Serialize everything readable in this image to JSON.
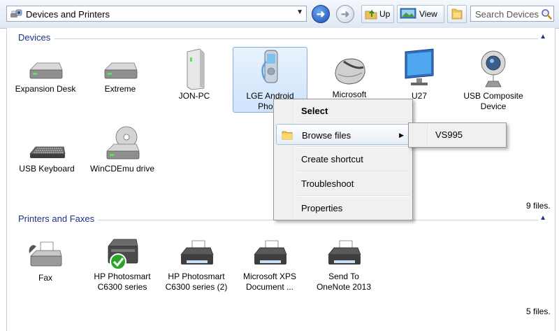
{
  "toolbar": {
    "address": "Devices and Printers",
    "up_label": "Up",
    "view_label": "View",
    "search_placeholder": "Search Devices"
  },
  "groups": {
    "devices": {
      "title": "Devices",
      "count": "9 files.",
      "items": [
        {
          "label": [
            "Expansion Desk",
            ""
          ]
        },
        {
          "label": [
            "Extreme",
            ""
          ]
        },
        {
          "label": [
            "JON-PC",
            ""
          ]
        },
        {
          "label": [
            "LGE Android",
            "Phone"
          ]
        },
        {
          "label": [
            "Microsoft",
            ""
          ]
        },
        {
          "label": [
            "U27",
            ""
          ]
        },
        {
          "label": [
            "USB Composite",
            "Device"
          ]
        },
        {
          "label": [
            "USB Keyboard",
            ""
          ]
        },
        {
          "label": [
            "WinCDEmu drive",
            ""
          ]
        }
      ]
    },
    "printers": {
      "title": "Printers and Faxes",
      "count": "5 files.",
      "items": [
        {
          "label": [
            "Fax",
            ""
          ]
        },
        {
          "label": [
            "HP Photosmart",
            "C6300 series"
          ]
        },
        {
          "label": [
            "HP Photosmart",
            "C6300 series (2)"
          ]
        },
        {
          "label": [
            "Microsoft XPS",
            "Document ..."
          ]
        },
        {
          "label": [
            "Send To",
            "OneNote 2013"
          ]
        }
      ]
    }
  },
  "context_menu": {
    "items": [
      {
        "label": "Select"
      },
      {
        "label": "Browse files"
      },
      {
        "label": "Create shortcut"
      },
      {
        "label": "Troubleshoot"
      },
      {
        "label": "Properties"
      }
    ],
    "submenu": {
      "label": "VS995"
    }
  },
  "colors": {
    "group_title": "#1e3287",
    "selection_border": "#84acdd"
  }
}
